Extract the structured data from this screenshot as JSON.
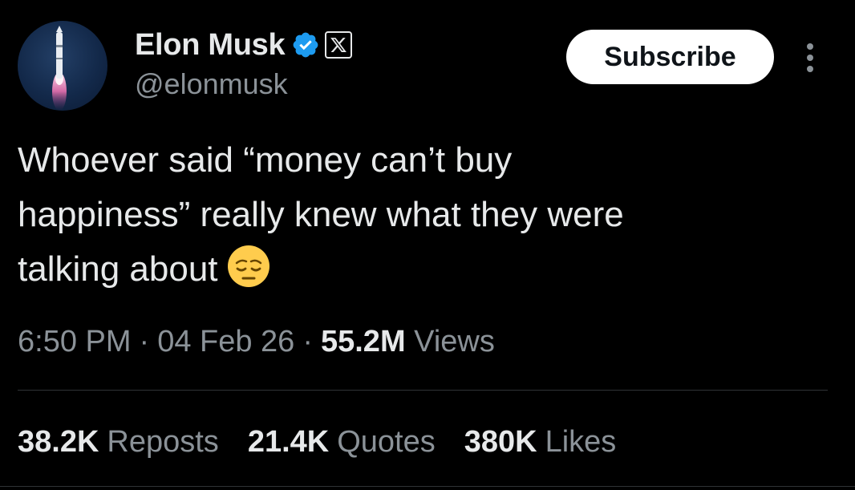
{
  "author": {
    "display_name": "Elon Musk",
    "handle": "@elonmusk",
    "verified_icon": "verified-badge-icon",
    "affiliate_icon": "x-logo-icon",
    "avatar_icon": "rocket-launch-avatar"
  },
  "actions": {
    "subscribe_label": "Subscribe",
    "more_icon": "more-vertical-icon"
  },
  "tweet": {
    "text": "Whoever said “money can’t buy\nhappiness” really knew what they were\ntalking about",
    "emoji": "pensive-face-emoji"
  },
  "meta": {
    "time": "6:50 PM",
    "separator": "·",
    "date": "04 Feb 26",
    "views_count": "55.2M",
    "views_label": "Views"
  },
  "stats": [
    {
      "count": "38.2K",
      "label": "Reposts"
    },
    {
      "count": "21.4K",
      "label": "Quotes"
    },
    {
      "count": "380K",
      "label": "Likes"
    }
  ],
  "colors": {
    "background": "#000000",
    "text_primary": "#e7e9ea",
    "text_secondary": "#8b9298",
    "verified_blue": "#1d9bf0",
    "divider": "#2f3336",
    "button_bg": "#ffffff"
  }
}
